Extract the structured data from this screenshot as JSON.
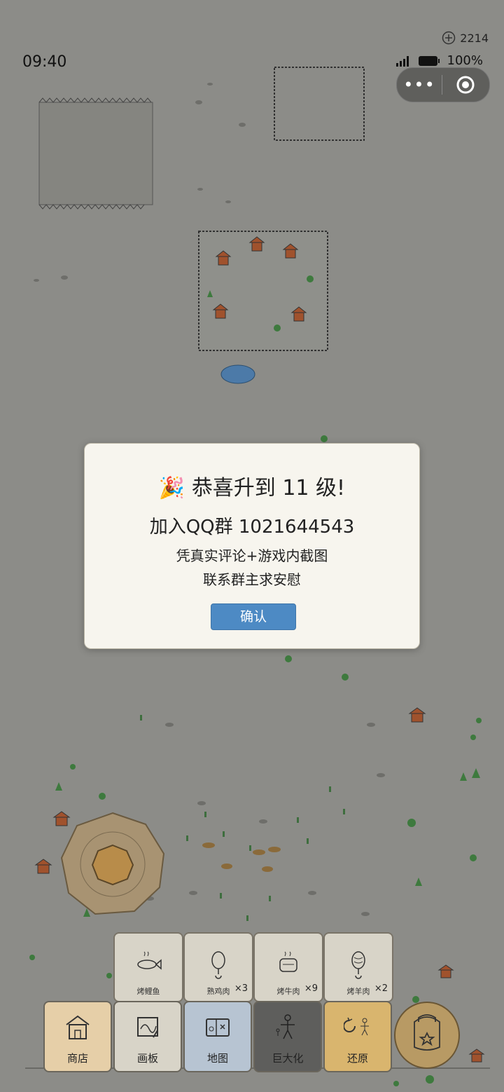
{
  "status_bar": {
    "time": "09:40",
    "battery": "100%"
  },
  "coins": {
    "icon": "plus-circle-icon",
    "value": "2214"
  },
  "capsule": {
    "more": "•••",
    "close_icon": "target-icon"
  },
  "dialog": {
    "emoji": "🎉",
    "title": "恭喜升到 11 级!",
    "qq_line": "加入QQ群 1021644543",
    "line1": "凭真实评论+游戏内截图",
    "line2": "联系群主求安慰",
    "confirm_label": "确认"
  },
  "food_slots": [
    {
      "label": "烤鲤鱼",
      "count": "",
      "icon": "fish-icon"
    },
    {
      "label": "熟鸡肉",
      "count": "×3",
      "icon": "drumstick-icon"
    },
    {
      "label": "烤牛肉",
      "count": "×9",
      "icon": "beef-icon"
    },
    {
      "label": "烤羊肉",
      "count": "×2",
      "icon": "mutton-icon"
    }
  ],
  "menu": [
    {
      "label": "商店",
      "icon": "shop-icon",
      "bg": "#e6cfa8"
    },
    {
      "label": "画板",
      "icon": "drawing-board-icon",
      "bg": "#d8d4c8"
    },
    {
      "label": "地图",
      "icon": "map-icon",
      "bg": "#b7c4d2"
    },
    {
      "label": "巨大化",
      "icon": "giant-icon",
      "bg": "#5e5e5c"
    },
    {
      "label": "还原",
      "icon": "restore-icon",
      "bg": "#d9b56e"
    }
  ],
  "colors": {
    "dim_background": "#8c8c88",
    "button_blue": "#4d8ac4",
    "dialog_bg": "#f7f5ee"
  }
}
